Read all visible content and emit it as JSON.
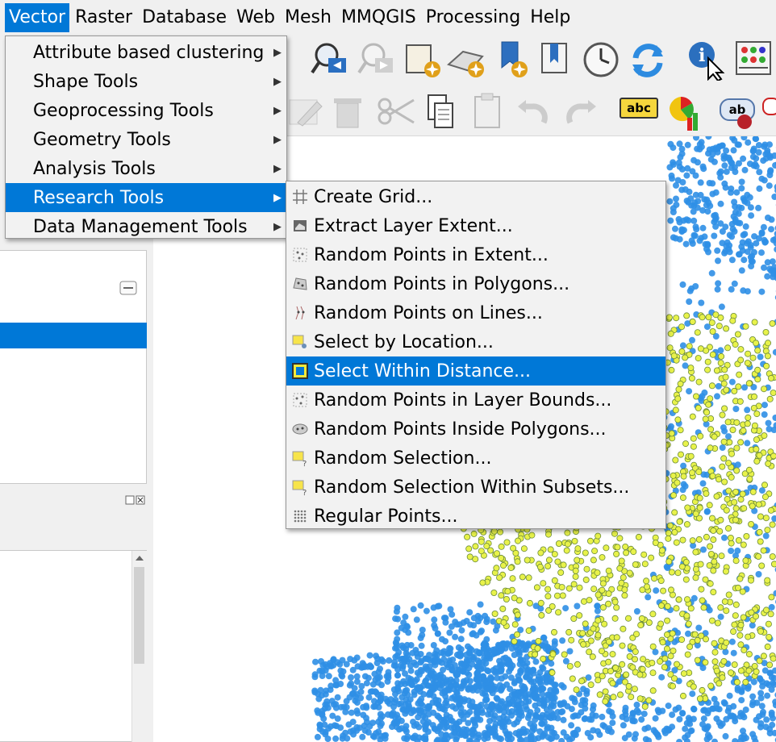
{
  "menubar": {
    "items": [
      "Vector",
      "Raster",
      "Database",
      "Web",
      "Mesh",
      "MMQGIS",
      "Processing",
      "Help"
    ]
  },
  "vector_menu": {
    "items": [
      {
        "label": "Attribute based clustering"
      },
      {
        "label": "Shape Tools"
      },
      {
        "label": "Geoprocessing Tools"
      },
      {
        "label": "Geometry Tools"
      },
      {
        "label": "Analysis Tools"
      },
      {
        "label": "Research Tools"
      },
      {
        "label": "Data Management Tools"
      }
    ]
  },
  "research_menu": {
    "items": [
      {
        "label": "Create Grid...",
        "icon": "grid-icon"
      },
      {
        "label": "Extract Layer Extent...",
        "icon": "extent-icon"
      },
      {
        "label": "Random Points in Extent...",
        "icon": "random-points-icon"
      },
      {
        "label": "Random Points in Polygons...",
        "icon": "random-points-polygon-icon"
      },
      {
        "label": "Random Points on Lines...",
        "icon": "random-points-lines-icon"
      },
      {
        "label": "Select by Location...",
        "icon": "select-location-icon"
      },
      {
        "label": "Select Within Distance...",
        "icon": "select-distance-icon"
      },
      {
        "label": "Random Points in Layer Bounds...",
        "icon": "random-points-bounds-icon"
      },
      {
        "label": "Random Points Inside Polygons...",
        "icon": "random-points-inside-icon"
      },
      {
        "label": "Random Selection...",
        "icon": "random-selection-icon"
      },
      {
        "label": "Random Selection Within Subsets...",
        "icon": "random-selection-subsets-icon"
      },
      {
        "label": "Regular Points...",
        "icon": "regular-points-icon"
      }
    ]
  },
  "toolbar": {
    "label_abc": "abc",
    "label_ab": "ab"
  },
  "colors": {
    "accent": "#0078d7",
    "points_blue": "#2f8fe6",
    "points_yellow": "#e8f24a"
  }
}
